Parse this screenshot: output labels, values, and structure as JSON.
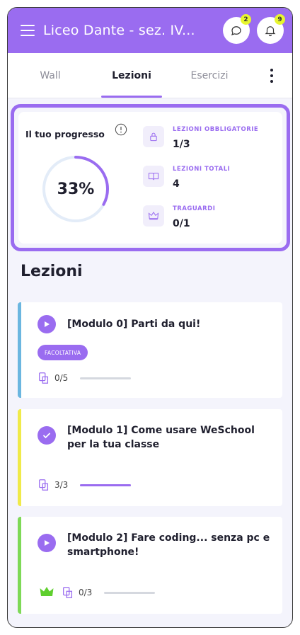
{
  "header": {
    "title": "Liceo Dante - sez. IV...",
    "chat_badge": "2",
    "notifications_badge": "9"
  },
  "tabs": [
    {
      "label": "Wall"
    },
    {
      "label": "Lezioni"
    },
    {
      "label": "Esercizi"
    }
  ],
  "progress": {
    "title": "Il tuo progresso",
    "percent_label": "33%",
    "percent_value": 0.33,
    "stats": [
      {
        "label": "LEZIONI OBBLIGATORIE",
        "value": "1/3",
        "icon": "lock-icon"
      },
      {
        "label": "LEZIONI TOTALI",
        "value": "4",
        "icon": "book-icon"
      },
      {
        "label": "TRAGUARDI",
        "value": "0/1",
        "icon": "crown-icon"
      }
    ]
  },
  "lessons_section": {
    "title": "Lezioni",
    "items": [
      {
        "title": "[Modulo 0] Parti da qui!",
        "tag": "FACOLTATIVA",
        "count": "0/5",
        "progress": 0,
        "strip_color": "#6bb6e0",
        "status_icon": "play-icon"
      },
      {
        "title": "[Modulo 1] Come usare WeSchool per la tua classe",
        "count": "3/3",
        "progress": 1,
        "strip_color": "#f0ea4a",
        "status_icon": "check-icon"
      },
      {
        "title": "[Modulo 2] Fare coding... senza pc e smartphone!",
        "count": "0/3",
        "progress": 0,
        "strip_color": "#7ed957",
        "status_icon": "play-icon",
        "crown": true
      }
    ]
  },
  "colors": {
    "accent": "#9a6cf0",
    "badge": "#e7f52f",
    "crown": "#5fcf2e"
  }
}
